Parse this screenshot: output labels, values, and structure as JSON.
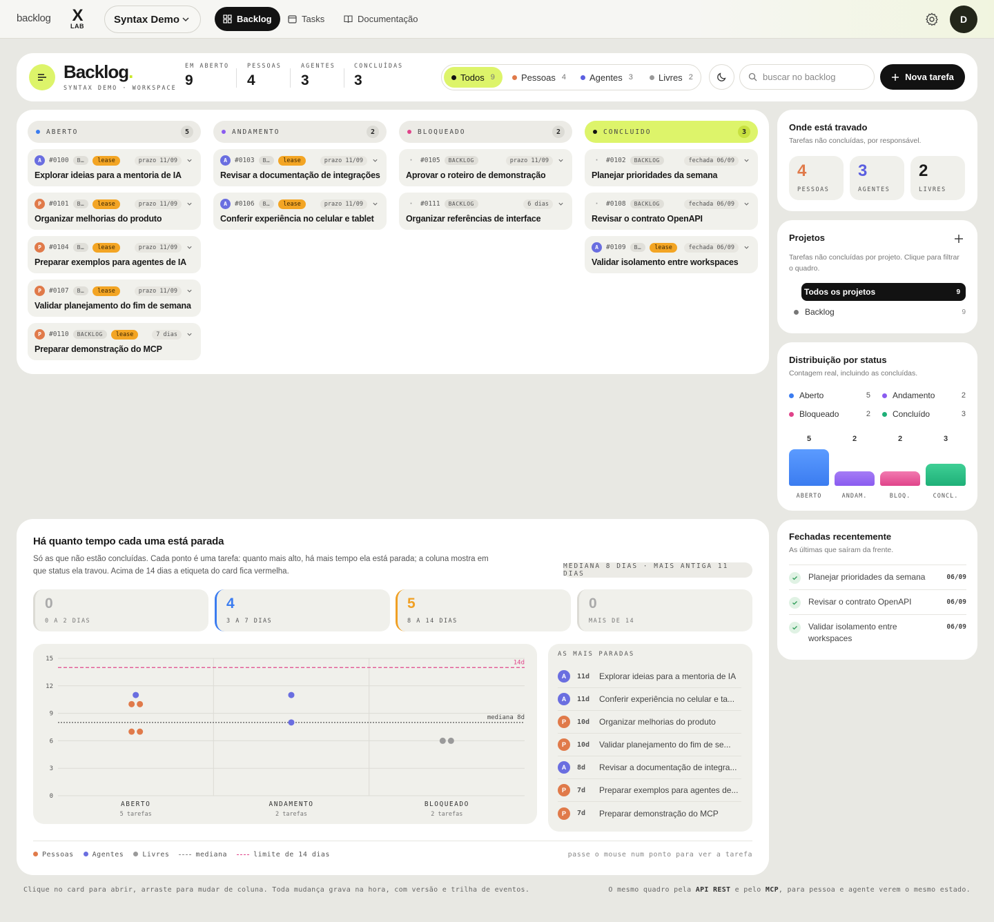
{
  "nav": {
    "brand": "backlog",
    "lab_x": "X",
    "lab_text": "LAB",
    "workspace": "Syntax Demo",
    "items": [
      "Backlog",
      "Tasks",
      "Documentação"
    ],
    "user_initial": "D"
  },
  "header": {
    "title": "Backlog",
    "title_dot": ".",
    "subtitle": "SYNTAX DEMO · WORKSPACE",
    "stats": [
      {
        "label": "EM ABERTO",
        "value": "9",
        "color": "#1a1a1a"
      },
      {
        "label": "PESSOAS",
        "value": "4",
        "color": "#e07a4a"
      },
      {
        "label": "AGENTES",
        "value": "3",
        "color": "#5b5fe0"
      },
      {
        "label": "CONCLUÍDAS",
        "value": "3",
        "color": "#1f9a6a"
      }
    ],
    "filters": [
      {
        "label": "Todos",
        "count": "9",
        "color": "#121212",
        "active": true
      },
      {
        "label": "Pessoas",
        "count": "4",
        "color": "#e07a4a",
        "active": false
      },
      {
        "label": "Agentes",
        "count": "3",
        "color": "#5b5fe0",
        "active": false
      },
      {
        "label": "Livres",
        "count": "2",
        "color": "#999999",
        "active": false
      }
    ],
    "search_placeholder": "buscar no backlog",
    "new_task": "Nova tarefa"
  },
  "board": {
    "columns": [
      {
        "name": "ABERTO",
        "count": "5",
        "color": "#3b7cf0",
        "cards": [
          {
            "avatar": "A",
            "id": "#0100",
            "tag": "B…",
            "lease": "lease",
            "due": "prazo 11/09",
            "title": "Explorar ideias para a mentoria de IA"
          },
          {
            "avatar": "P",
            "id": "#0101",
            "tag": "B…",
            "lease": "lease",
            "due": "prazo 11/09",
            "title": "Organizar melhorias do produto"
          },
          {
            "avatar": "P",
            "id": "#0104",
            "tag": "B…",
            "lease": "lease",
            "due": "prazo 11/09",
            "title": "Preparar exemplos para agentes de IA"
          },
          {
            "avatar": "P",
            "id": "#0107",
            "tag": "B…",
            "lease": "lease",
            "due": "prazo 11/09",
            "title": "Validar planejamento do fim de semana"
          },
          {
            "avatar": "P",
            "id": "#0110",
            "tag": "BACKLOG",
            "lease": "lease",
            "due": "7 dias",
            "title": "Preparar demonstração do MCP"
          }
        ]
      },
      {
        "name": "ANDAMENTO",
        "count": "2",
        "color": "#8a5cf0",
        "cards": [
          {
            "avatar": "A",
            "id": "#0103",
            "tag": "B…",
            "lease": "lease",
            "due": "prazo 11/09",
            "title": "Revisar a documentação de integrações"
          },
          {
            "avatar": "A",
            "id": "#0106",
            "tag": "B…",
            "lease": "lease",
            "due": "prazo 11/09",
            "title": "Conferir experiência no celular e tablet"
          }
        ]
      },
      {
        "name": "BLOQUEADO",
        "count": "2",
        "color": "#e0448a",
        "cards": [
          {
            "avatar": "·",
            "id": "#0105",
            "tag": "BACKLOG",
            "lease": "",
            "due": "prazo 11/09",
            "title": "Aprovar o roteiro de demonstração"
          },
          {
            "avatar": "·",
            "id": "#0111",
            "tag": "BACKLOG",
            "lease": "",
            "due": "6 dias",
            "title": "Organizar referências de interface"
          }
        ]
      },
      {
        "name": "CONCLUIDO",
        "count": "3",
        "color": "#121212",
        "cards": [
          {
            "avatar": "·",
            "id": "#0102",
            "tag": "BACKLOG",
            "lease": "",
            "due": "fechada 06/09",
            "title": "Planejar prioridades da semana"
          },
          {
            "avatar": "·",
            "id": "#0108",
            "tag": "BACKLOG",
            "lease": "",
            "due": "fechada 06/09",
            "title": "Revisar o contrato OpenAPI"
          },
          {
            "avatar": "A",
            "id": "#0109",
            "tag": "B…",
            "lease": "lease",
            "due": "fechada 06/09",
            "title": "Validar isolamento entre workspaces"
          }
        ]
      }
    ]
  },
  "stuck": {
    "title": "Onde está travado",
    "subtitle": "Tarefas não concluídas, por responsável.",
    "items": [
      {
        "value": "4",
        "label": "PESSOAS",
        "color": "#e07a4a"
      },
      {
        "value": "3",
        "label": "AGENTES",
        "color": "#5b5fe0"
      },
      {
        "value": "2",
        "label": "LIVRES",
        "color": "#1a1a1a"
      }
    ]
  },
  "projects": {
    "title": "Projetos",
    "subtitle": "Tarefas não concluídas por projeto. Clique para filtrar o quadro.",
    "all_label": "Todos os projetos",
    "all_count": "9",
    "items": [
      {
        "name": "Backlog",
        "count": "9"
      }
    ]
  },
  "distribution": {
    "title": "Distribuição por status",
    "subtitle": "Contagem real, incluindo as concluídas.",
    "items": [
      {
        "name": "Aberto",
        "count": "5",
        "color": "#3b7cf0"
      },
      {
        "name": "Andamento",
        "count": "2",
        "color": "#8a5cf0"
      },
      {
        "name": "Bloqueado",
        "count": "2",
        "color": "#e0448a"
      },
      {
        "name": "Concluído",
        "count": "3",
        "color": "#1fb078"
      }
    ],
    "chart_data": {
      "type": "bar",
      "categories": [
        "ABERTO",
        "ANDAM.",
        "BLOQ.",
        "CONCL."
      ],
      "values": [
        5,
        2,
        2,
        3
      ],
      "colors": [
        [
          "#5b9bff",
          "#3b7cf0"
        ],
        [
          "#a57cf5",
          "#8a5cf0"
        ],
        [
          "#f27ab0",
          "#e0448a"
        ],
        [
          "#3fcf95",
          "#1fb078"
        ]
      ]
    }
  },
  "closed": {
    "title": "Fechadas recentemente",
    "subtitle": "As últimas que saíram da frente.",
    "items": [
      {
        "title": "Planejar prioridades da semana",
        "date": "06/09"
      },
      {
        "title": "Revisar o contrato OpenAPI",
        "date": "06/09"
      },
      {
        "title": "Validar isolamento entre workspaces",
        "date": "06/09"
      }
    ]
  },
  "aging": {
    "title": "Há quanto tempo cada uma está parada",
    "description": "Só as que não estão concluídas. Cada ponto é uma tarefa: quanto mais alto, há mais tempo ela está parada; a coluna mostra em que status ela travou. Acima de 14 dias a etiqueta do card fica vermelha.",
    "median_pill": "MEDIANA 8 DIAS · MAIS ANTIGA 11 DIAS",
    "buckets": [
      {
        "value": "0",
        "label": "0 A 2 DIAS",
        "color": "#aaaaaa"
      },
      {
        "value": "4",
        "label": "3 A 7 DIAS",
        "color": "#3b7cf0"
      },
      {
        "value": "5",
        "label": "8 A 14 DIAS",
        "color": "#f0a024"
      },
      {
        "value": "0",
        "label": "MAIS DE 14",
        "color": "#aaaaaa"
      }
    ],
    "chart_data": {
      "type": "scatter",
      "categories": [
        "ABERTO",
        "ANDAMENTO",
        "BLOQUEADO"
      ],
      "category_counts": [
        "5 tarefas",
        "2 tarefas",
        "2 tarefas"
      ],
      "yticks": [
        0,
        3,
        6,
        9,
        12,
        15
      ],
      "ylim": [
        0,
        15
      ],
      "median": 8,
      "median_label": "mediana 8d",
      "limit": 14,
      "limit_label": "14d",
      "points": [
        {
          "category": "ABERTO",
          "y": 11,
          "kind": "agente",
          "offset": 0
        },
        {
          "category": "ABERTO",
          "y": 10,
          "kind": "pessoa",
          "offset": -1
        },
        {
          "category": "ABERTO",
          "y": 10,
          "kind": "pessoa",
          "offset": 1
        },
        {
          "category": "ABERTO",
          "y": 7,
          "kind": "pessoa",
          "offset": -1
        },
        {
          "category": "ABERTO",
          "y": 7,
          "kind": "pessoa",
          "offset": 1
        },
        {
          "category": "ANDAMENTO",
          "y": 11,
          "kind": "agente",
          "offset": 0
        },
        {
          "category": "ANDAMENTO",
          "y": 8,
          "kind": "agente",
          "offset": 0
        },
        {
          "category": "BLOQUEADO",
          "y": 6,
          "kind": "livre",
          "offset": -1
        },
        {
          "category": "BLOQUEADO",
          "y": 6,
          "kind": "livre",
          "offset": 1
        }
      ],
      "colors": {
        "pessoa": "#e07a4a",
        "agente": "#6a6ee0",
        "livre": "#9a9a9a"
      }
    },
    "stale_title": "AS MAIS PARADAS",
    "stale": [
      {
        "avatar": "A",
        "days": "11d",
        "title": "Explorar ideias para a mentoria de IA"
      },
      {
        "avatar": "A",
        "days": "11d",
        "title": "Conferir experiência no celular e ta..."
      },
      {
        "avatar": "P",
        "days": "10d",
        "title": "Organizar melhorias do produto"
      },
      {
        "avatar": "P",
        "days": "10d",
        "title": "Validar planejamento do fim de se..."
      },
      {
        "avatar": "A",
        "days": "8d",
        "title": "Revisar a documentação de integra..."
      },
      {
        "avatar": "P",
        "days": "7d",
        "title": "Preparar exemplos para agentes de..."
      },
      {
        "avatar": "P",
        "days": "7d",
        "title": "Preparar demonstração do MCP"
      }
    ],
    "legend": [
      "Pessoas",
      "Agentes",
      "Livres",
      "mediana",
      "limite de 14 dias"
    ],
    "hint": "passe o mouse num ponto para ver a tarefa"
  },
  "footer": {
    "left": "Clique no card para abrir, arraste para mudar de coluna. Toda mudança grava na hora, com versão e trilha de eventos.",
    "right_a": "O mesmo quadro pela ",
    "right_api": "API REST",
    "right_b": " e pelo ",
    "right_mcp": "MCP",
    "right_c": ", para pessoa e agente verem o mesmo estado."
  }
}
